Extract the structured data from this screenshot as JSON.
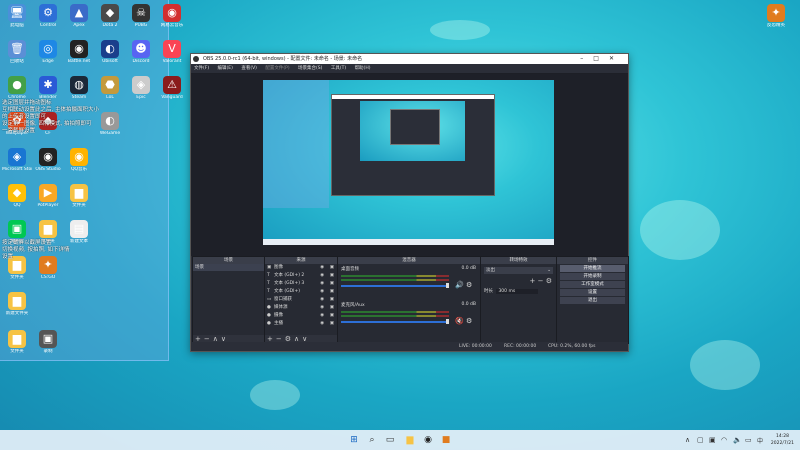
{
  "desktop": {
    "icons": [
      {
        "label": "此电脑",
        "glyph": "🖥",
        "bg": "#4a90d9"
      },
      {
        "label": "Control",
        "glyph": "⚙",
        "bg": "#2d6fd6"
      },
      {
        "label": "Apex",
        "glyph": "▲",
        "bg": "#3a6bc8"
      },
      {
        "label": "Dota 2",
        "glyph": "◆",
        "bg": "#4a4a4a"
      },
      {
        "label": "PUBG",
        "glyph": "☠",
        "bg": "#333"
      },
      {
        "label": "网易云音乐",
        "glyph": "◉",
        "bg": "#d32f2f"
      },
      {
        "label": "回收站",
        "glyph": "🗑",
        "bg": "#5b8fd6"
      },
      {
        "label": "Edge",
        "glyph": "◎",
        "bg": "#1e88e5"
      },
      {
        "label": "Battle.net",
        "glyph": "◉",
        "bg": "#222"
      },
      {
        "label": "Ubisoft",
        "glyph": "◐",
        "bg": "#1a3f8c"
      },
      {
        "label": "Discord",
        "glyph": "☻",
        "bg": "#5865f2"
      },
      {
        "label": "Valorant",
        "glyph": "V",
        "bg": "#fa4454"
      },
      {
        "label": "Chrome",
        "glyph": "●",
        "bg": "#43a047"
      },
      {
        "label": "Blender",
        "glyph": "✱",
        "bg": "#2a5ad6"
      },
      {
        "label": "Steam",
        "glyph": "◍",
        "bg": "#1b2838"
      },
      {
        "label": "LoL",
        "glyph": "⬣",
        "bg": "#c49a3c"
      },
      {
        "label": "Epic",
        "glyph": "◈",
        "bg": "#ccc"
      },
      {
        "label": "Vanguard",
        "glyph": "⚠",
        "bg": "#8a1c1c"
      },
      {
        "label": "Wallpaper",
        "glyph": "✿",
        "bg": "#e64a19"
      },
      {
        "label": "CF",
        "glyph": "◆",
        "bg": "#aa2222"
      },
      {
        "label": "WeGame",
        "glyph": "◐",
        "bg": "#999"
      },
      {
        "label": "Microsoft Store",
        "glyph": "◈",
        "bg": "#1976d2"
      },
      {
        "label": "OBS Studio",
        "glyph": "◉",
        "bg": "#222"
      },
      {
        "label": "QQ音乐",
        "glyph": "◉",
        "bg": "#ffb300"
      },
      {
        "label": "QQ",
        "glyph": "◆",
        "bg": "#ffc107"
      },
      {
        "label": "PotPlayer",
        "glyph": "▶",
        "bg": "#f9a825"
      },
      {
        "label": "文件夹",
        "glyph": "▆",
        "bg": "#f6c344"
      },
      {
        "label": "爱奇艺",
        "glyph": "▣",
        "bg": "#00c853"
      },
      {
        "label": "文件夹",
        "glyph": "▆",
        "bg": "#f6c344"
      },
      {
        "label": "新建文本",
        "glyph": "▤",
        "bg": "#eee"
      },
      {
        "label": "文件夹",
        "glyph": "▆",
        "bg": "#f6c344"
      },
      {
        "label": "CS:GO",
        "glyph": "✦",
        "bg": "#e07c1f"
      },
      {
        "label": "新建文件夹",
        "glyph": "▆",
        "bg": "#f6c344"
      },
      {
        "label": "文件夹",
        "glyph": "▆",
        "bg": "#f6c344"
      },
      {
        "label": "录制",
        "glyph": "▣",
        "bg": "#555"
      }
    ],
    "overlay_lines": [
      "选定图层并拖动图标",
      "互相联动设置此之后, 主体拍摄面积大小",
      "的上传者设置即可",
      "设定第一图像, 四种模式, 拍拍照即可",
      "一旁截屏设置"
    ],
    "overlay_lines2": [
      "按定截屏以截屏设置",
      "切换视频, 按拍照, 如下详情",
      "设置"
    ],
    "top_right_icon": {
      "label": "反恐精英",
      "glyph": "✦",
      "bg": "#e07c1f"
    }
  },
  "obs": {
    "title": "OBS 25.0.0-rc1 (64-bit, windows) - 配置文件: 未命名 - 场景: 未命名",
    "menu": [
      "文件(F)",
      "编辑(E)",
      "查看(V)",
      "配置文件(P)",
      "场景集合(S)",
      "工具(T)",
      "帮助(H)"
    ],
    "docks": {
      "scenes": {
        "title": "场景",
        "items": [
          "场景"
        ]
      },
      "sources": {
        "title": "来源",
        "items": [
          {
            "icon": "▣",
            "label": "图像"
          },
          {
            "icon": "T",
            "label": "文本 (GDI+) 2"
          },
          {
            "icon": "T",
            "label": "文本 (GDI+) 3"
          },
          {
            "icon": "T",
            "label": "文本 (GDI+)"
          },
          {
            "icon": "▭",
            "label": "窗口捕获"
          },
          {
            "icon": "●",
            "label": "媒体源"
          },
          {
            "icon": "●",
            "label": "摄像"
          },
          {
            "icon": "●",
            "label": "主播"
          }
        ]
      },
      "mixer": {
        "title": "混音器",
        "channels": [
          {
            "name": "桌面音频",
            "db": "0.0 dB"
          },
          {
            "name": "麦克风/Aux",
            "db": "0.0 dB"
          }
        ]
      },
      "transitions": {
        "title": "转场特效",
        "type": "淡出",
        "duration_label": "时长",
        "duration": "300 ms"
      },
      "controls": {
        "title": "控件",
        "buttons": [
          "开始推流",
          "开始录制",
          "工作室模式",
          "设置",
          "退出"
        ]
      }
    },
    "status": {
      "live": "LIVE: 00:00:00",
      "rec": "REC: 00:00:00",
      "cpu": "CPU: 0.2%, 60.00 fps"
    }
  },
  "taskbar": {
    "time": "14:28",
    "date": "2022/7/21"
  }
}
